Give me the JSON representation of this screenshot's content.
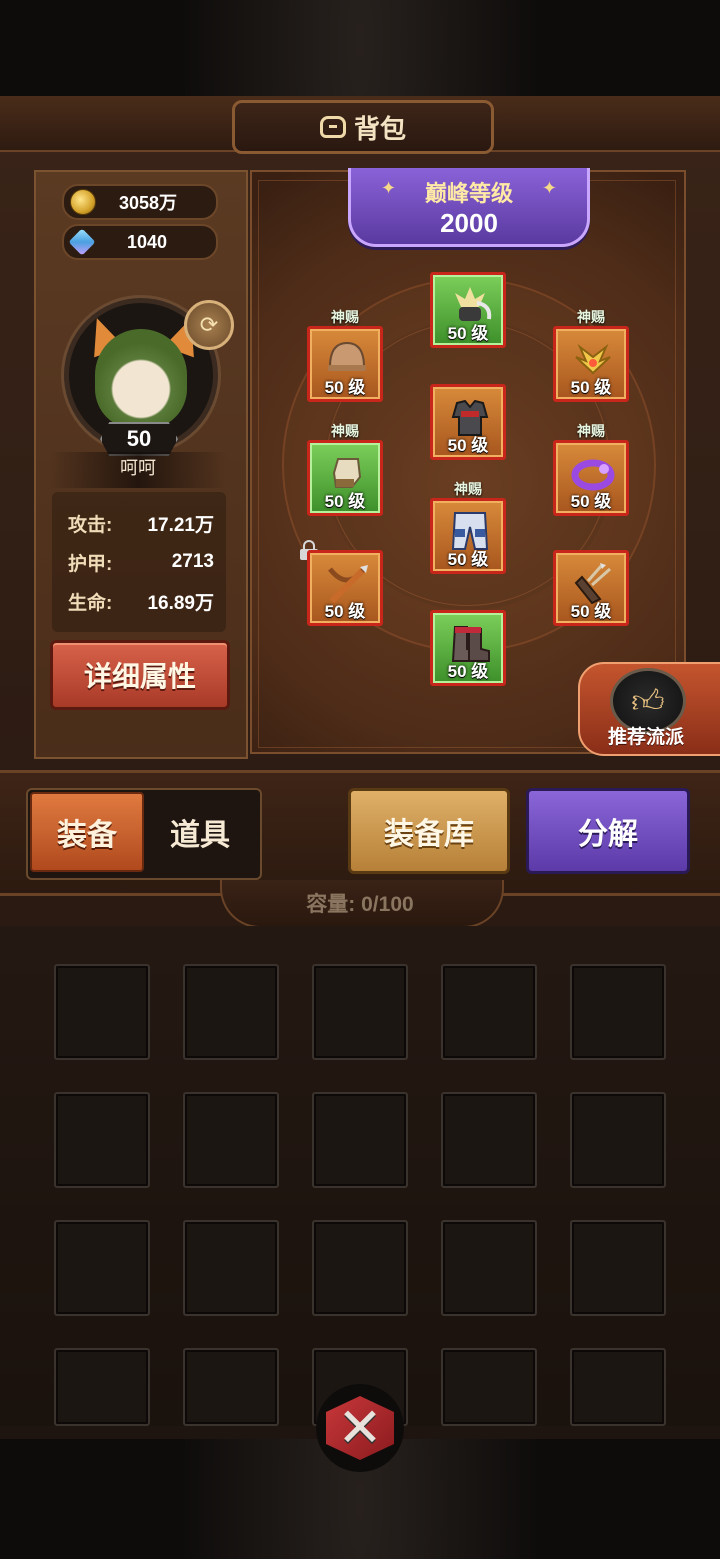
{
  "header": {
    "title": "背包",
    "icon": "bag-icon"
  },
  "currency": {
    "gold": {
      "icon": "coin-icon",
      "value": "3058万"
    },
    "gems": {
      "icon": "gem-icon",
      "value": "1040"
    }
  },
  "player": {
    "level": "50",
    "name": "呵呵",
    "stats": [
      {
        "label": "攻击:",
        "value": "17.21万"
      },
      {
        "label": "护甲:",
        "value": "2713"
      },
      {
        "label": "生命:",
        "value": "16.89万"
      }
    ],
    "detail_button": "详细属性"
  },
  "peak": {
    "title": "巅峰等级",
    "value": "2000"
  },
  "equipment": {
    "gift_label": "神赐",
    "slots": [
      {
        "id": "helmet-top",
        "level": "50 级",
        "gift": false,
        "rarity": "green"
      },
      {
        "id": "helmet",
        "level": "50 级",
        "gift": true,
        "rarity": "orange"
      },
      {
        "id": "amulet",
        "level": "50 级",
        "gift": true,
        "rarity": "orange"
      },
      {
        "id": "armor",
        "level": "50 级",
        "gift": false,
        "rarity": "orange"
      },
      {
        "id": "gloves",
        "level": "50 级",
        "gift": true,
        "rarity": "green"
      },
      {
        "id": "pants",
        "level": "50 级",
        "gift": true,
        "rarity": "orange"
      },
      {
        "id": "ring",
        "level": "50 级",
        "gift": true,
        "rarity": "orange"
      },
      {
        "id": "crossbow",
        "level": "50 级",
        "gift": false,
        "rarity": "orange",
        "locked": true
      },
      {
        "id": "quiver",
        "level": "50 级",
        "gift": false,
        "rarity": "orange"
      },
      {
        "id": "boots",
        "level": "50 级",
        "gift": false,
        "rarity": "green"
      }
    ]
  },
  "recommend": {
    "label": "推荐流派"
  },
  "tabs": {
    "equip": "装备",
    "items": "道具"
  },
  "buttons": {
    "library": "装备库",
    "decompose": "分解"
  },
  "capacity": "容量: 0/100",
  "colors": {
    "accent_orange": "#d8624a",
    "accent_purple": "#6a48c0",
    "slot_border": "#c8261a"
  }
}
